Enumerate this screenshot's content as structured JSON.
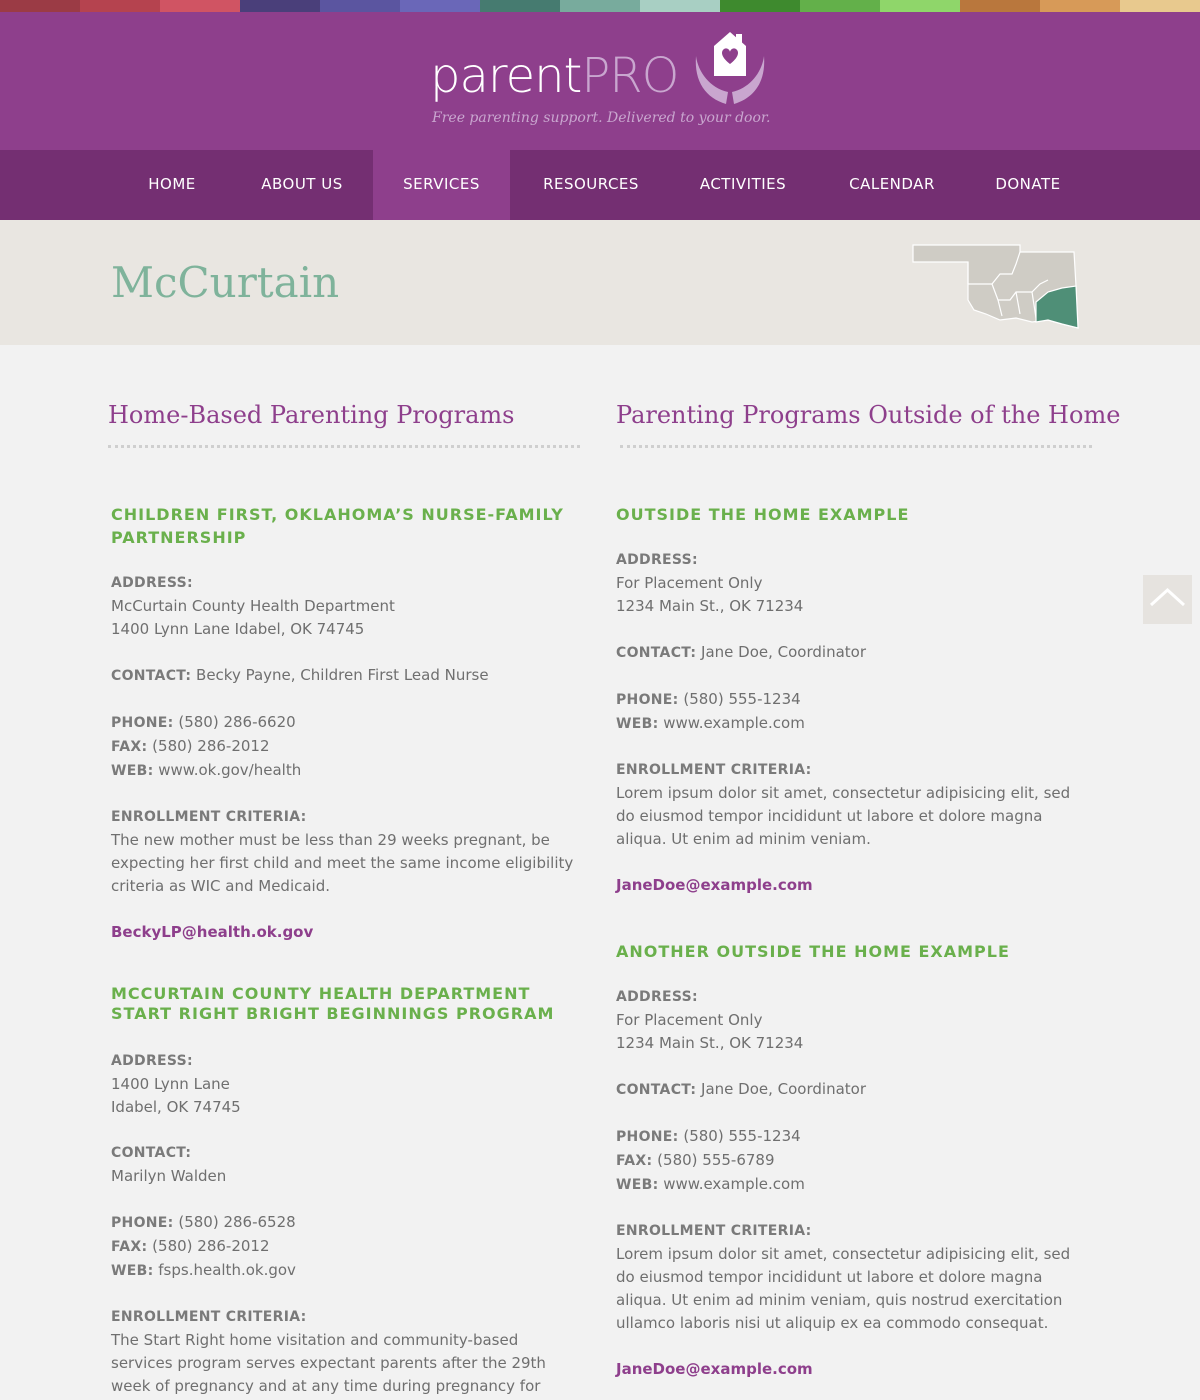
{
  "color_strip": [
    "#9b3b45",
    "#b5434f",
    "#d05463",
    "#4a3f7a",
    "#5b55a0",
    "#6a67b8",
    "#467b70",
    "#78ab9d",
    "#a8cfc3",
    "#3e8a2e",
    "#63b04a",
    "#8fd66a",
    "#b9773d",
    "#d79a58",
    "#e8c98e"
  ],
  "brand": {
    "word_main": "parent",
    "word_pro": "PRO",
    "tagline": "Free parenting support. Delivered to your door."
  },
  "nav": {
    "items": [
      {
        "label": "HOME"
      },
      {
        "label": "ABOUT US"
      },
      {
        "label": "SERVICES",
        "active": true
      },
      {
        "label": "RESOURCES"
      },
      {
        "label": "ACTIVITIES"
      },
      {
        "label": "CALENDAR"
      },
      {
        "label": "DONATE"
      }
    ]
  },
  "page": {
    "title": "McCurtain"
  },
  "left_column": {
    "heading": "Home-Based Parenting Programs",
    "programs": [
      {
        "title": "CHILDREN FIRST, OKLAHOMA’S NURSE-FAMILY PARTNERSHIP",
        "address_label": "ADDRESS:",
        "address_line1": "McCurtain County Health Department",
        "address_line2": "1400 Lynn Lane Idabel, OK 74745",
        "contact_label": "CONTACT:",
        "contact": "Becky Payne, Children First Lead Nurse",
        "phone_label": "PHONE:",
        "phone": "(580) 286-6620",
        "fax_label": "FAX:",
        "fax": "(580) 286-2012",
        "web_label": "WEB:",
        "web": "www.ok.gov/health",
        "criteria_label": "ENROLLMENT CRITERIA:",
        "criteria": "The new mother must be less than 29 weeks pregnant, be expecting her first child and meet the same income eligibility criteria as WIC and Medicaid.",
        "email": "BeckyLP@health.ok.gov"
      },
      {
        "title": "MCCURTAIN COUNTY HEALTH DEPARTMENT START RIGHT BRIGHT BEGINNINGS PROGRAM",
        "address_label": "ADDRESS:",
        "address_line1": "1400 Lynn Lane",
        "address_line2": "Idabel, OK 74745",
        "contact_label": "CONTACT:",
        "contact": "Marilyn Walden",
        "phone_label": "PHONE:",
        "phone": " (580) 286-6528",
        "fax_label": "FAX:",
        "fax": "(580) 286-2012",
        "web_label": "WEB:",
        "web": "fsps.health.ok.gov",
        "criteria_label": "ENROLLMENT CRITERIA:",
        "criteria": "The Start Right home visitation and community-based services program serves expectant parents after the 29th week of pregnancy and at any time during pregnancy for subsequent"
      }
    ]
  },
  "right_column": {
    "heading": "Parenting Programs Outside of the Home",
    "programs": [
      {
        "title": "OUTSIDE THE HOME EXAMPLE",
        "address_label": "ADDRESS:",
        "address_line1": "For Placement Only",
        "address_line2": "1234 Main St., OK 71234",
        "contact_label": "CONTACT:",
        "contact": "Jane Doe, Coordinator",
        "phone_label": "PHONE:",
        "phone": "(580) 555-1234",
        "web_label": "WEB:",
        "web": "www.example.com",
        "criteria_label": "ENROLLMENT CRITERIA:",
        "criteria": "Lorem ipsum dolor sit amet, consectetur adipisicing elit, sed do eiusmod tempor incididunt ut labore et dolore magna aliqua. Ut enim ad minim veniam.",
        "email": "JaneDoe@example.com"
      },
      {
        "title": "ANOTHER OUTSIDE THE HOME EXAMPLE",
        "address_label": "ADDRESS:",
        "address_line1": "For Placement Only",
        "address_line2": "1234 Main St., OK 71234",
        "contact_label": "CONTACT:",
        "contact": "Jane Doe, Coordinator",
        "phone_label": "PHONE:",
        "phone": "(580) 555-1234",
        "fax_label": "FAX:",
        "fax": "(580) 555-6789",
        "web_label": "WEB:",
        "web": "www.example.com",
        "criteria_label": "ENROLLMENT CRITERIA:",
        "criteria": "Lorem ipsum dolor sit amet, consectetur adipisicing elit, sed do eiusmod tempor incididunt ut labore et dolore magna aliqua. Ut enim ad minim veniam, quis nostrud exercitation ullamco laboris nisi ut aliquip ex ea commodo consequat.",
        "email": "JaneDoe@example.com"
      }
    ]
  },
  "icons": {
    "scroll_top": "chevron-up-icon",
    "logo_mark": "house-heart-hands-icon",
    "county_map": "oklahoma-county-map-icon"
  },
  "colors": {
    "brand_purple": "#8e3f8c",
    "nav_purple": "#742f72",
    "accent_green": "#6ab04c",
    "title_teal": "#7fb39b",
    "map_highlight": "#4f8f77"
  }
}
